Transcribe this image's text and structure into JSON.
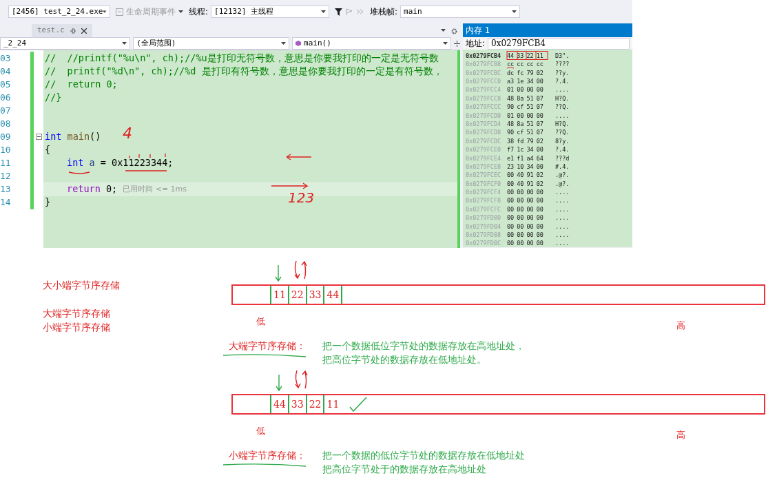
{
  "toolbar": {
    "process": "[2456] test_2_24.exe",
    "lifecycle": "生命周期事件",
    "thread_label": "线程:",
    "thread": "[12132] 主线程",
    "stack_label": "堆栈帧:",
    "stack": "main"
  },
  "editor": {
    "tab": {
      "label": "test.c",
      "selected": true
    },
    "nav": [
      "_2_24",
      "(全局范围)",
      "main()"
    ],
    "lines": [
      {
        "number": "03",
        "tokens": [
          {
            "kind": "comment",
            "text": "//  //printf(\"%u\\n\", ch);//%u是打印无符号数，意思是你要我打印的一定是无符号数"
          }
        ]
      },
      {
        "number": "04",
        "tokens": [
          {
            "kind": "comment",
            "text": "//  printf(\"%d\\n\", ch);//%d 是打印有符号数，意思是你要我打印的一定是有符号数，"
          }
        ]
      },
      {
        "number": "05",
        "tokens": [
          {
            "kind": "comment",
            "text": "//  return 0;"
          }
        ]
      },
      {
        "number": "06",
        "tokens": [
          {
            "kind": "comment",
            "text": "//}"
          }
        ]
      },
      {
        "number": "07"
      },
      {
        "number": "08"
      },
      {
        "number": "09",
        "fold": true,
        "tokens": [
          {
            "kind": "keyword",
            "text": "int"
          },
          {
            "kind": "function",
            "text": " main"
          },
          {
            "kind": "plain",
            "text": "()"
          }
        ]
      },
      {
        "number": "10",
        "tokens": [
          {
            "kind": "plain",
            "text": "{"
          }
        ]
      },
      {
        "number": "11",
        "indented": true,
        "tokens": [
          {
            "kind": "keyword",
            "text": "int"
          },
          {
            "kind": "variable",
            "text": " a"
          },
          {
            "kind": "plain",
            "text": " = 0x11223344;"
          }
        ]
      },
      {
        "number": "12"
      },
      {
        "number": "13",
        "current": true,
        "indented": true,
        "tokens": [
          {
            "kind": "control",
            "text": "return"
          },
          {
            "kind": "plain",
            "text": " 0;"
          }
        ],
        "hint": "已用时间 <= 1ms"
      },
      {
        "number": "14",
        "tokens": [
          {
            "kind": "plain",
            "text": "}"
          }
        ]
      }
    ],
    "annotations": [
      {
        "text": "4"
      },
      {
        "text": "123"
      }
    ]
  },
  "memory": {
    "title": "内存 1",
    "address_label": "地址:",
    "address": "0x0279FCB4",
    "rows": [
      {
        "address": "0x0279FCB4",
        "selected": true,
        "bytes": [
          "44",
          "33",
          "22",
          "11"
        ],
        "ascii": "D3\"."
      },
      {
        "address": "0x0279FCB8",
        "selected": false,
        "bytes": [
          "cc",
          "cc",
          "cc",
          "cc"
        ],
        "ascii": "????"
      },
      {
        "address": "0x0279FCBC",
        "selected": false,
        "bytes": [
          "dc",
          "fc",
          "79",
          "02"
        ],
        "ascii": "??y."
      },
      {
        "address": "0x0279FCC0",
        "selected": false,
        "bytes": [
          "a3",
          "1e",
          "34",
          "00"
        ],
        "ascii": "?.4."
      },
      {
        "address": "0x0279FCC4",
        "selected": false,
        "bytes": [
          "01",
          "00",
          "00",
          "00"
        ],
        "ascii": "...."
      },
      {
        "address": "0x0279FCC8",
        "selected": false,
        "bytes": [
          "48",
          "8a",
          "51",
          "07"
        ],
        "ascii": "H?Q."
      },
      {
        "address": "0x0279FCCC",
        "selected": false,
        "bytes": [
          "90",
          "cf",
          "51",
          "07"
        ],
        "ascii": "??Q."
      },
      {
        "address": "0x0279FCD0",
        "selected": false,
        "bytes": [
          "01",
          "00",
          "00",
          "00"
        ],
        "ascii": "...."
      },
      {
        "address": "0x0279FCD4",
        "selected": false,
        "bytes": [
          "48",
          "8a",
          "51",
          "07"
        ],
        "ascii": "H?Q."
      },
      {
        "address": "0x0279FCD8",
        "selected": false,
        "bytes": [
          "90",
          "cf",
          "51",
          "07"
        ],
        "ascii": "??Q."
      },
      {
        "address": "0x0279FCDC",
        "selected": false,
        "bytes": [
          "38",
          "fd",
          "79",
          "02"
        ],
        "ascii": "8?y."
      },
      {
        "address": "0x0279FCE0",
        "selected": false,
        "bytes": [
          "f7",
          "1c",
          "34",
          "00"
        ],
        "ascii": "?.4."
      },
      {
        "address": "0x0279FCE4",
        "selected": false,
        "bytes": [
          "e1",
          "f1",
          "a4",
          "64"
        ],
        "ascii": "???d"
      },
      {
        "address": "0x0279FCE8",
        "selected": false,
        "bytes": [
          "23",
          "10",
          "34",
          "00"
        ],
        "ascii": "#.4."
      },
      {
        "address": "0x0279FCEC",
        "selected": false,
        "bytes": [
          "00",
          "40",
          "91",
          "02"
        ],
        "ascii": ".@?."
      },
      {
        "address": "0x0279FCF0",
        "selected": false,
        "bytes": [
          "00",
          "40",
          "91",
          "02"
        ],
        "ascii": ".@?."
      },
      {
        "address": "0x0279FCF4",
        "selected": false,
        "bytes": [
          "00",
          "00",
          "00",
          "00"
        ],
        "ascii": "...."
      },
      {
        "address": "0x0279FCF8",
        "selected": false,
        "bytes": [
          "00",
          "00",
          "00",
          "00"
        ],
        "ascii": "...."
      },
      {
        "address": "0x0279FCFC",
        "selected": false,
        "bytes": [
          "00",
          "00",
          "00",
          "00"
        ],
        "ascii": "...."
      },
      {
        "address": "0x0279FD00",
        "selected": false,
        "bytes": [
          "00",
          "00",
          "00",
          "00"
        ],
        "ascii": "...."
      },
      {
        "address": "0x0279FD04",
        "selected": false,
        "bytes": [
          "00",
          "00",
          "00",
          "00"
        ],
        "ascii": "...."
      },
      {
        "address": "0x0279FD08",
        "selected": false,
        "bytes": [
          "00",
          "00",
          "00",
          "00"
        ],
        "ascii": "...."
      },
      {
        "address": "0x0279FD0C",
        "selected": false,
        "bytes": [
          "00",
          "00",
          "00",
          "00"
        ],
        "ascii": "...."
      }
    ]
  },
  "notes": {
    "heading": "大小端字节序存储",
    "terms": [
      "大端字节序存储",
      "小端字节序存储"
    ],
    "diagrams": [
      {
        "cells": [
          "11",
          "22",
          "33",
          "44"
        ],
        "low": "低",
        "high": "高",
        "term": "大端字节序存储：",
        "lines": [
          "把一个数据低位字节处的数据存放在高地址处，",
          "把高位字节处的数据存放在低地址处。"
        ],
        "check": false
      },
      {
        "cells": [
          "44",
          "33",
          "22",
          "11"
        ],
        "low": "低",
        "high": "高",
        "term": "小端字节序存储：",
        "lines": [
          "把一个数据的低位字节处的数据存放在低地址处",
          "把高位字节处于的数据存放在高地址处"
        ],
        "check": true
      }
    ]
  }
}
